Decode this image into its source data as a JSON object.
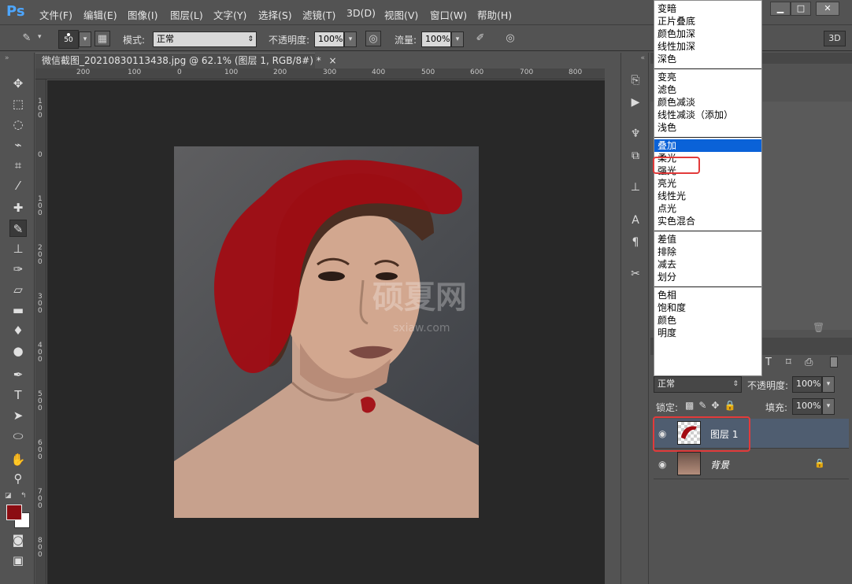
{
  "app": {
    "logo": "Ps"
  },
  "menu": [
    "文件(F)",
    "编辑(E)",
    "图像(I)",
    "图层(L)",
    "文字(Y)",
    "选择(S)",
    "滤镜(T)",
    "3D(D)",
    "视图(V)",
    "窗口(W)",
    "帮助(H)"
  ],
  "window_controls": {
    "minimize": "▁",
    "maximize": "□",
    "close": "✕"
  },
  "options": {
    "brush_size": "50",
    "mode_label": "模式:",
    "mode_value": "正常",
    "opacity_label": "不透明度:",
    "opacity_value": "100%",
    "flow_label": "流量:",
    "flow_value": "100%",
    "three_d_button": "3D"
  },
  "document": {
    "tab_title": "微信截图_20210830113438.jpg @ 62.1% (图层 1, RGB/8#) *",
    "tab_close": "×",
    "ruler_h": [
      "200",
      "100",
      "0",
      "100",
      "200",
      "300",
      "400",
      "500",
      "600",
      "700",
      "800"
    ],
    "ruler_v": [
      "1\n0\n0",
      "0",
      "1\n0\n0",
      "2\n0\n0",
      "3\n0\n0",
      "4\n0\n0",
      "5\n0\n0",
      "6\n0\n0",
      "7\n0\n0",
      "8\n0\n0"
    ],
    "watermark_main": "硕夏网",
    "watermark_sub": "sxiaw.com"
  },
  "blend_modes": [
    [
      "变暗",
      "正片叠底",
      "颜色加深",
      "线性加深",
      "深色"
    ],
    [
      "变亮",
      "滤色",
      "颜色减淡",
      "线性减淡（添加）",
      "浅色"
    ],
    [
      "叠加",
      "柔光",
      "强光",
      "亮光",
      "线性光",
      "点光",
      "实色混合"
    ],
    [
      "差值",
      "排除",
      "减去",
      "划分"
    ],
    [
      "色相",
      "饱和度",
      "颜色",
      "明度"
    ]
  ],
  "selected_blend_mode": "叠加",
  "layers_panel": {
    "blend_value": "正常",
    "opacity_label": "不透明度:",
    "opacity_value": "100%",
    "lock_label": "锁定:",
    "fill_label": "填充:",
    "fill_value": "100%",
    "layers": [
      {
        "name": "图层 1",
        "selected": true
      },
      {
        "name": "背景",
        "locked": true
      }
    ]
  },
  "colors": {
    "foreground": "#8b0d12",
    "background": "#ffffff",
    "selection": "#0a62d8",
    "highlight_box": "#e23b3b"
  }
}
